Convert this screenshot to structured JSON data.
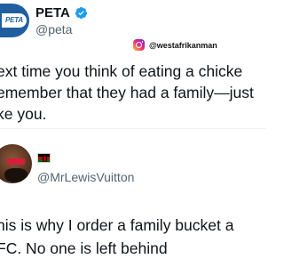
{
  "tweet1": {
    "avatar_text": "PETA",
    "display_name": "PETA",
    "verified": true,
    "handle": "@peta",
    "text_lines": [
      "ext time you think of eating a chicke",
      "emember that they had a family—just",
      "ke you."
    ]
  },
  "watermark": {
    "icon": "instagram-icon",
    "text": "@westafrikanman"
  },
  "tweet2": {
    "flag_icon": "kenya-flag-icon",
    "handle": "@MrLewisVuitton",
    "text_lines": [
      "his is why I order a family bucket a",
      "FC. No one is left behind"
    ]
  },
  "colors": {
    "text": "#0f1419",
    "secondary_text": "#536471",
    "verified_blue": "#1d9bf0",
    "peta_blue": "#1f5fa0"
  }
}
